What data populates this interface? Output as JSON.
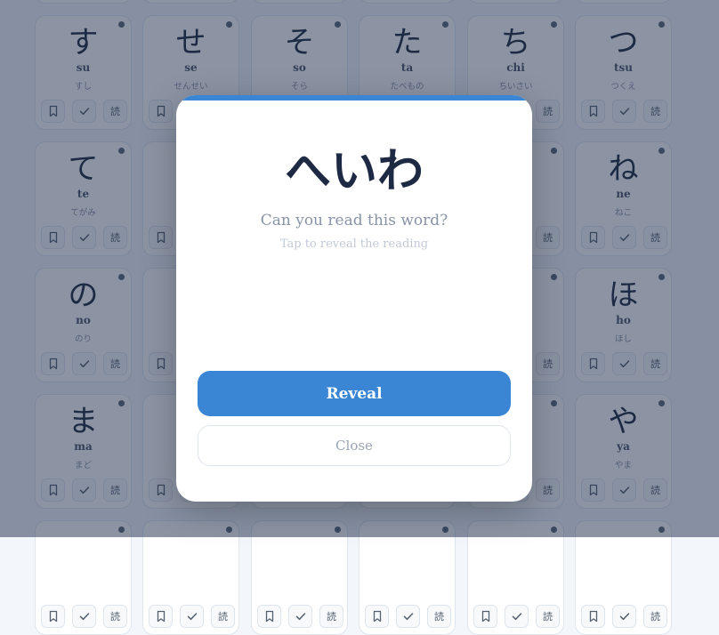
{
  "colors": {
    "accent": "#3a86d4",
    "overlay": "rgba(26,42,74,0.50)"
  },
  "grid": {
    "action_labels": {
      "bookmark_icon": "bookmark-icon",
      "check_icon": "check-icon",
      "read_label": "読"
    },
    "rows": [
      [
        {
          "kana": "",
          "romaji": "",
          "word": ""
        },
        {
          "kana": "",
          "romaji": "",
          "word": ""
        },
        {
          "kana": "",
          "romaji": "",
          "word": ""
        },
        {
          "kana": "",
          "romaji": "",
          "word": ""
        },
        {
          "kana": "",
          "romaji": "",
          "word": ""
        },
        {
          "kana": "",
          "romaji": "",
          "word": ""
        }
      ],
      [
        {
          "kana": "す",
          "romaji": "su",
          "word": "すし"
        },
        {
          "kana": "せ",
          "romaji": "se",
          "word": "せんせい"
        },
        {
          "kana": "そ",
          "romaji": "so",
          "word": "そら"
        },
        {
          "kana": "た",
          "romaji": "ta",
          "word": "たべもの"
        },
        {
          "kana": "ち",
          "romaji": "chi",
          "word": "ちいさい"
        },
        {
          "kana": "つ",
          "romaji": "tsu",
          "word": "つくえ"
        }
      ],
      [
        {
          "kana": "て",
          "romaji": "te",
          "word": "てがみ"
        },
        {
          "kana": "",
          "romaji": "",
          "word": ""
        },
        {
          "kana": "",
          "romaji": "",
          "word": ""
        },
        {
          "kana": "",
          "romaji": "",
          "word": ""
        },
        {
          "kana": "",
          "romaji": "",
          "word": ""
        },
        {
          "kana": "ね",
          "romaji": "ne",
          "word": "ねこ"
        }
      ],
      [
        {
          "kana": "の",
          "romaji": "no",
          "word": "のり"
        },
        {
          "kana": "",
          "romaji": "",
          "word": ""
        },
        {
          "kana": "",
          "romaji": "",
          "word": ""
        },
        {
          "kana": "",
          "romaji": "",
          "word": ""
        },
        {
          "kana": "",
          "romaji": "",
          "word": ""
        },
        {
          "kana": "ほ",
          "romaji": "ho",
          "word": "ほし"
        }
      ],
      [
        {
          "kana": "ま",
          "romaji": "ma",
          "word": "まど"
        },
        {
          "kana": "",
          "romaji": "",
          "word": ""
        },
        {
          "kana": "",
          "romaji": "",
          "word": ""
        },
        {
          "kana": "",
          "romaji": "",
          "word": ""
        },
        {
          "kana": "",
          "romaji": "",
          "word": ""
        },
        {
          "kana": "や",
          "romaji": "ya",
          "word": "やま"
        }
      ],
      [
        {
          "kana": "",
          "romaji": "",
          "word": ""
        },
        {
          "kana": "",
          "romaji": "",
          "word": ""
        },
        {
          "kana": "",
          "romaji": "",
          "word": ""
        },
        {
          "kana": "",
          "romaji": "",
          "word": ""
        },
        {
          "kana": "",
          "romaji": "",
          "word": ""
        },
        {
          "kana": "",
          "romaji": "",
          "word": ""
        }
      ]
    ]
  },
  "modal": {
    "word": "へいわ",
    "prompt": "Can you read this word?",
    "hint": "Tap to reveal the reading",
    "reveal_label": "Reveal",
    "close_label": "Close"
  }
}
